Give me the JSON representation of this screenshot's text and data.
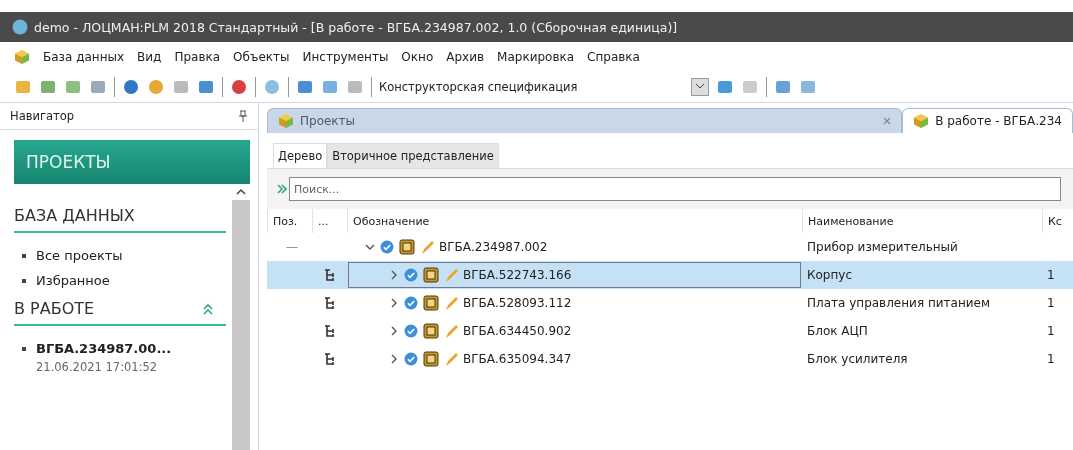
{
  "window": {
    "title": "demo - ЛОЦМАН:PLM 2018 Стандартный - [В работе - ВГБА.234987.002, 1.0 (Сборочная единица)]"
  },
  "menu": [
    "База данных",
    "Вид",
    "Правка",
    "Объекты",
    "Инструменты",
    "Окно",
    "Архив",
    "Маркировка",
    "Справка"
  ],
  "toolbar": {
    "combo_value": "Конструкторская спецификация"
  },
  "navigator": {
    "title": "Навигатор",
    "header": "ПРОЕКТЫ",
    "sections": [
      {
        "title": "БАЗА ДАННЫХ",
        "collapsible": false,
        "items": [
          {
            "label": "Все проекты",
            "kind": "link"
          },
          {
            "label": "Избранное",
            "kind": "link"
          }
        ]
      },
      {
        "title": "В РАБОТЕ",
        "collapsible": true,
        "items": [
          {
            "label": "ВГБА.234987.00...",
            "kind": "document",
            "date": "21.06.2021 17:01:52"
          }
        ]
      }
    ]
  },
  "doc_tabs": [
    {
      "label": "Проекты",
      "selected": false
    },
    {
      "label": "В работе - ВГБА.234",
      "selected": true
    }
  ],
  "view_tabs": [
    {
      "label": "Дерево",
      "selected": true
    },
    {
      "label": "Вторичное представление",
      "selected": false
    }
  ],
  "search": {
    "placeholder": "Поиск..."
  },
  "table": {
    "columns": [
      "Поз.",
      "...",
      "Обозначение",
      "Наименование",
      "Кс"
    ],
    "rows": [
      {
        "position": "—",
        "designation": "ВГБА.234987.002",
        "name": "Прибор измерительный",
        "expanded": true,
        "selected": false,
        "children": [
          {
            "designation": "ВГБА.522743.166",
            "name": "Корпус",
            "quantity": "1",
            "expanded": false,
            "selected": true
          },
          {
            "designation": "ВГБА.528093.112",
            "name": "Плата управления питанием",
            "quantity": "1",
            "expanded": false,
            "selected": false
          },
          {
            "designation": "ВГБА.634450.902",
            "name": "Блок АЦП",
            "quantity": "1",
            "expanded": false,
            "selected": false
          },
          {
            "designation": "ВГБА.635094.347",
            "name": "Блок усилителя",
            "quantity": "1",
            "expanded": false,
            "selected": false
          }
        ]
      }
    ]
  }
}
